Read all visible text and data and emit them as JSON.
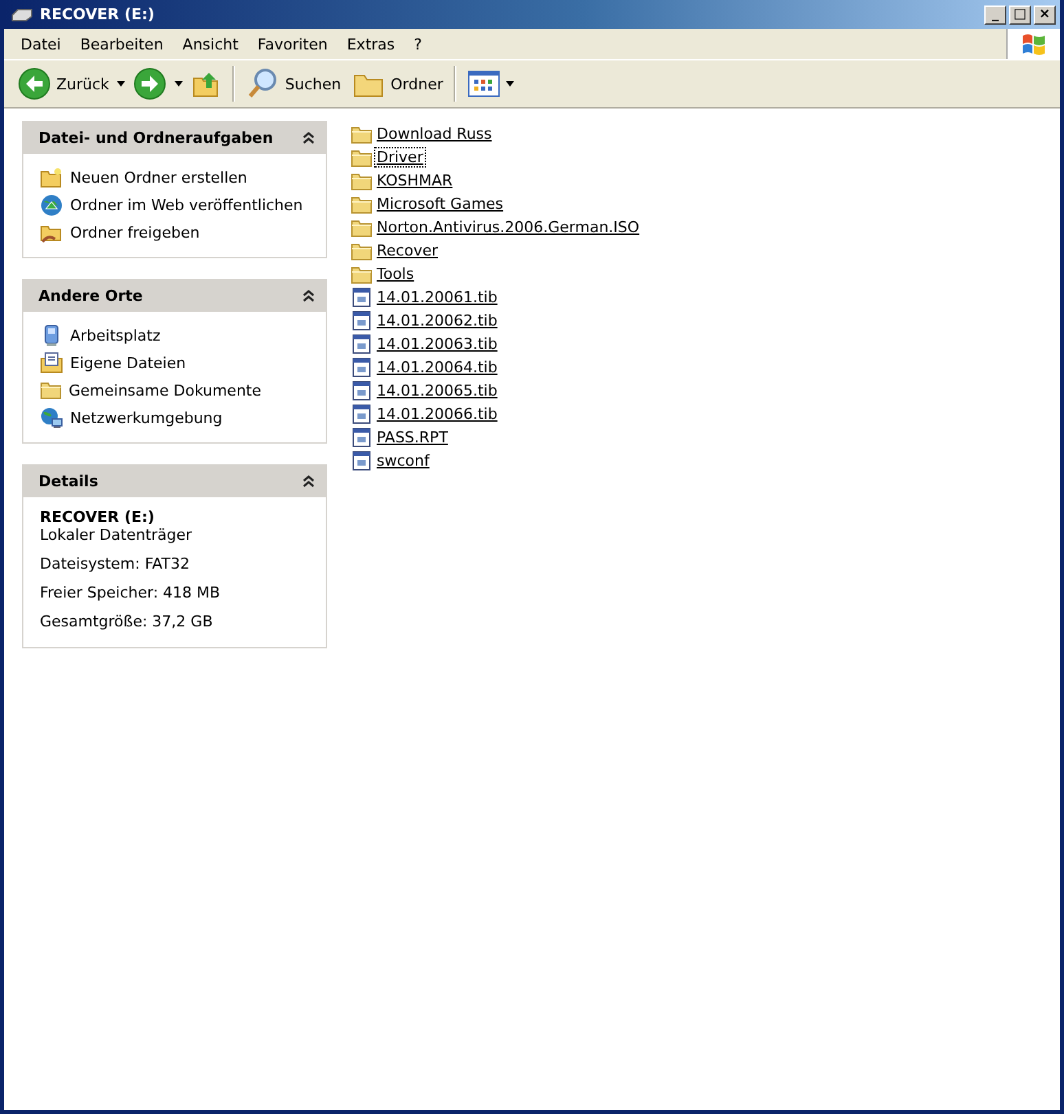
{
  "window": {
    "title": "RECOVER (E:)",
    "controls": [
      "_",
      "□",
      "×"
    ]
  },
  "menu": [
    "Datei",
    "Bearbeiten",
    "Ansicht",
    "Favoriten",
    "Extras",
    "?"
  ],
  "toolbar": {
    "back": "Zurück",
    "search": "Suchen",
    "folders": "Ordner"
  },
  "panels": [
    {
      "title": "Datei- und Ordneraufgaben",
      "expanded": true,
      "items": [
        {
          "label": "Neuen Ordner erstellen",
          "kind": "newfolder"
        },
        {
          "label": "Ordner im Web veröffentlichen",
          "kind": "web"
        },
        {
          "label": "Ordner freigeben",
          "kind": "share"
        }
      ]
    },
    {
      "title": "Andere Orte",
      "expanded": true,
      "items": [
        {
          "label": "Arbeitsplatz",
          "kind": "computer"
        },
        {
          "label": "Eigene Dateien",
          "kind": "documents"
        },
        {
          "label": "Gemeinsame Dokumente",
          "kind": "folder"
        },
        {
          "label": "Netzwerkumgebung",
          "kind": "network"
        }
      ]
    }
  ],
  "details": {
    "title": "Details",
    "expanded": true,
    "name": "RECOVER (E:)",
    "lines": [
      "Lokaler Datenträger",
      "Dateisystem: FAT32",
      "Freier Speicher: 418 MB",
      "Gesamtgröße: 37,2 GB"
    ]
  },
  "files": [
    {
      "name": "Download Russ",
      "kind": "folder",
      "focused": false
    },
    {
      "name": "Driver",
      "kind": "folder",
      "focused": true
    },
    {
      "name": "KOSHMAR",
      "kind": "folder",
      "focused": false
    },
    {
      "name": "Microsoft Games",
      "kind": "folder",
      "focused": false
    },
    {
      "name": "Norton.Antivirus.2006.German.ISO",
      "kind": "folder",
      "focused": false
    },
    {
      "name": "Recover",
      "kind": "folder",
      "focused": false
    },
    {
      "name": "Tools",
      "kind": "folder",
      "focused": false
    },
    {
      "name": "14.01.20061.tib",
      "kind": "file",
      "focused": false
    },
    {
      "name": "14.01.20062.tib",
      "kind": "file",
      "focused": false
    },
    {
      "name": "14.01.20063.tib",
      "kind": "file",
      "focused": false
    },
    {
      "name": "14.01.20064.tib",
      "kind": "file",
      "focused": false
    },
    {
      "name": "14.01.20065.tib",
      "kind": "file",
      "focused": false
    },
    {
      "name": "14.01.20066.tib",
      "kind": "file",
      "focused": false
    },
    {
      "name": "PASS.RPT",
      "kind": "file",
      "focused": false
    },
    {
      "name": "swconf",
      "kind": "file",
      "focused": false
    }
  ]
}
